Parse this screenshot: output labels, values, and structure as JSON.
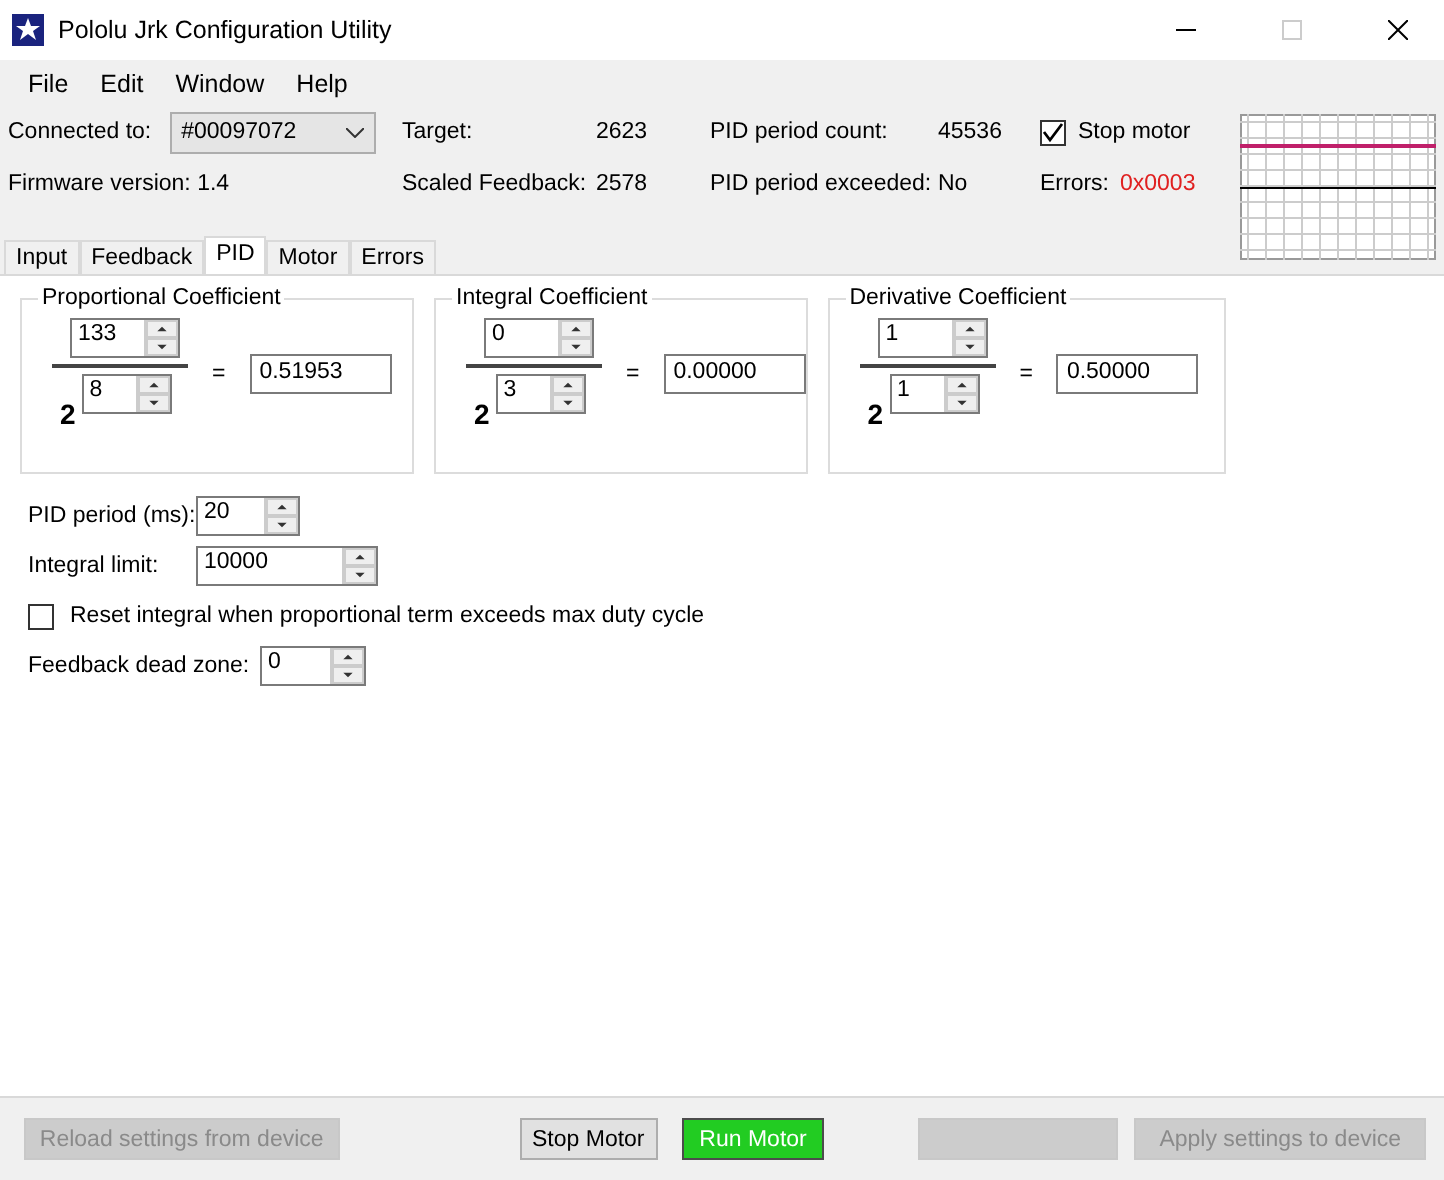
{
  "window": {
    "title": "Pololu Jrk Configuration Utility"
  },
  "menu": [
    "File",
    "Edit",
    "Window",
    "Help"
  ],
  "status": {
    "connected_label": "Connected to:",
    "device": "#00097072",
    "firmware": "Firmware version: 1.4",
    "target_label": "Target:",
    "target": "2623",
    "feedback_label": "Scaled Feedback:",
    "feedback": "2578",
    "pid_count_label": "PID period count:",
    "pid_count": "45536",
    "pid_exceeded_label": "PID period exceeded:",
    "pid_exceeded": "No",
    "stop_motor": {
      "label": "Stop motor",
      "checked": true
    },
    "errors_label": "Errors:",
    "errors": "0x0003"
  },
  "tabs": [
    {
      "label": "Input",
      "selected": false
    },
    {
      "label": "Feedback",
      "selected": false
    },
    {
      "label": "PID",
      "selected": true
    },
    {
      "label": "Motor",
      "selected": false
    },
    {
      "label": "Errors",
      "selected": false
    }
  ],
  "coefficients": [
    {
      "title": "Proportional Coefficient",
      "numerator": "133",
      "base": "2",
      "exponent": "8",
      "equals": "=",
      "result": "0.51953"
    },
    {
      "title": "Integral Coefficient",
      "numerator": "0",
      "base": "2",
      "exponent": "3",
      "equals": "=",
      "result": "0.00000"
    },
    {
      "title": "Derivative Coefficient",
      "numerator": "1",
      "base": "2",
      "exponent": "1",
      "equals": "=",
      "result": "0.50000"
    }
  ],
  "settings": [
    {
      "kind": "spin",
      "label": "PID period (ms):",
      "value": "20"
    },
    {
      "kind": "spin",
      "label": "Integral limit:",
      "value": "10000"
    },
    {
      "kind": "checkbox",
      "label": "Reset integral when proportional term exceeds max duty cycle",
      "checked": false
    },
    {
      "kind": "spin",
      "label": "Feedback dead zone:",
      "value": "0"
    }
  ],
  "buttons": [
    {
      "kind": "text",
      "label": "Reload settings from device",
      "disabled": true
    },
    {
      "kind": "text",
      "label": "Stop Motor",
      "disabled": false
    },
    {
      "kind": "run",
      "label": "Run Motor",
      "disabled": false
    },
    {
      "kind": "blank",
      "disabled": true
    },
    {
      "kind": "text",
      "label": "Apply settings to device",
      "disabled": true
    }
  ]
}
